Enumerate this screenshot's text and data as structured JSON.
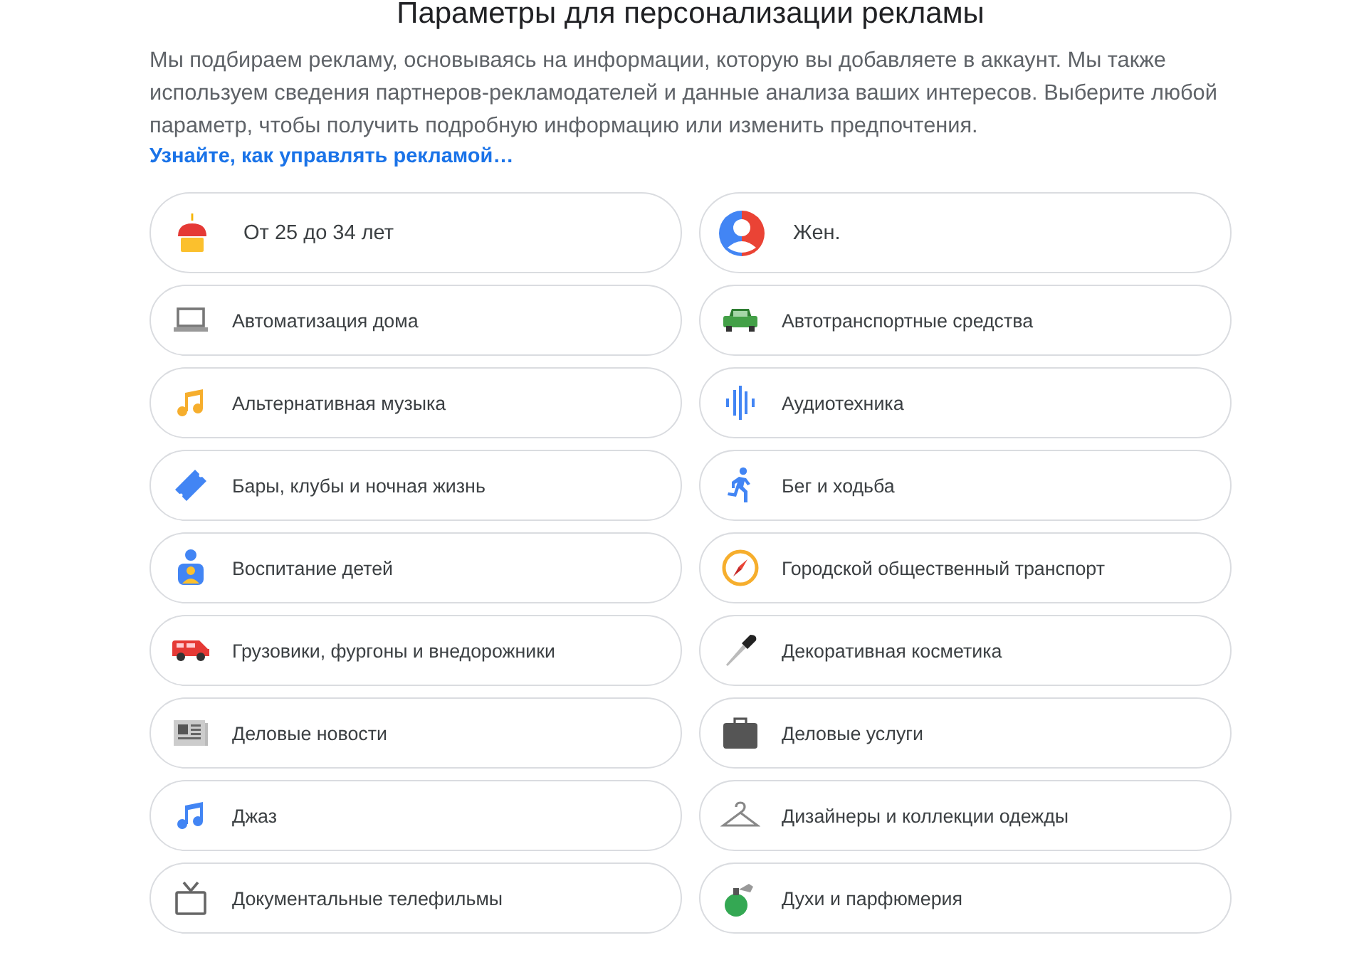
{
  "title": "Параметры для персонализации рекламы",
  "description": "Мы подбираем рекламу, основываясь на информации, которую вы добавляете в аккаунт. Мы также используем сведения партнеров-рекламодателей и данные анализа ваших интересов. Выберите любой параметр, чтобы получить подробную информацию или изменить предпочтения.",
  "link": "Узнайте, как управлять рекламой…",
  "factors": [
    {
      "label": "От 25 до 34 лет"
    },
    {
      "label": "Жен."
    },
    {
      "label": "Автоматизация дома"
    },
    {
      "label": "Автотранспортные средства"
    },
    {
      "label": "Альтернативная музыка"
    },
    {
      "label": "Аудиотехника"
    },
    {
      "label": "Бары, клубы и ночная жизнь"
    },
    {
      "label": "Бег и ходьба"
    },
    {
      "label": "Воспитание детей"
    },
    {
      "label": "Городской общественный транспорт"
    },
    {
      "label": "Грузовики, фургоны и внедорожники"
    },
    {
      "label": "Декоративная косметика"
    },
    {
      "label": "Деловые новости"
    },
    {
      "label": "Деловые услуги"
    },
    {
      "label": "Джаз"
    },
    {
      "label": "Дизайнеры и коллекции одежды"
    },
    {
      "label": "Документальные телефильмы"
    },
    {
      "label": "Духи и парфюмерия"
    }
  ]
}
